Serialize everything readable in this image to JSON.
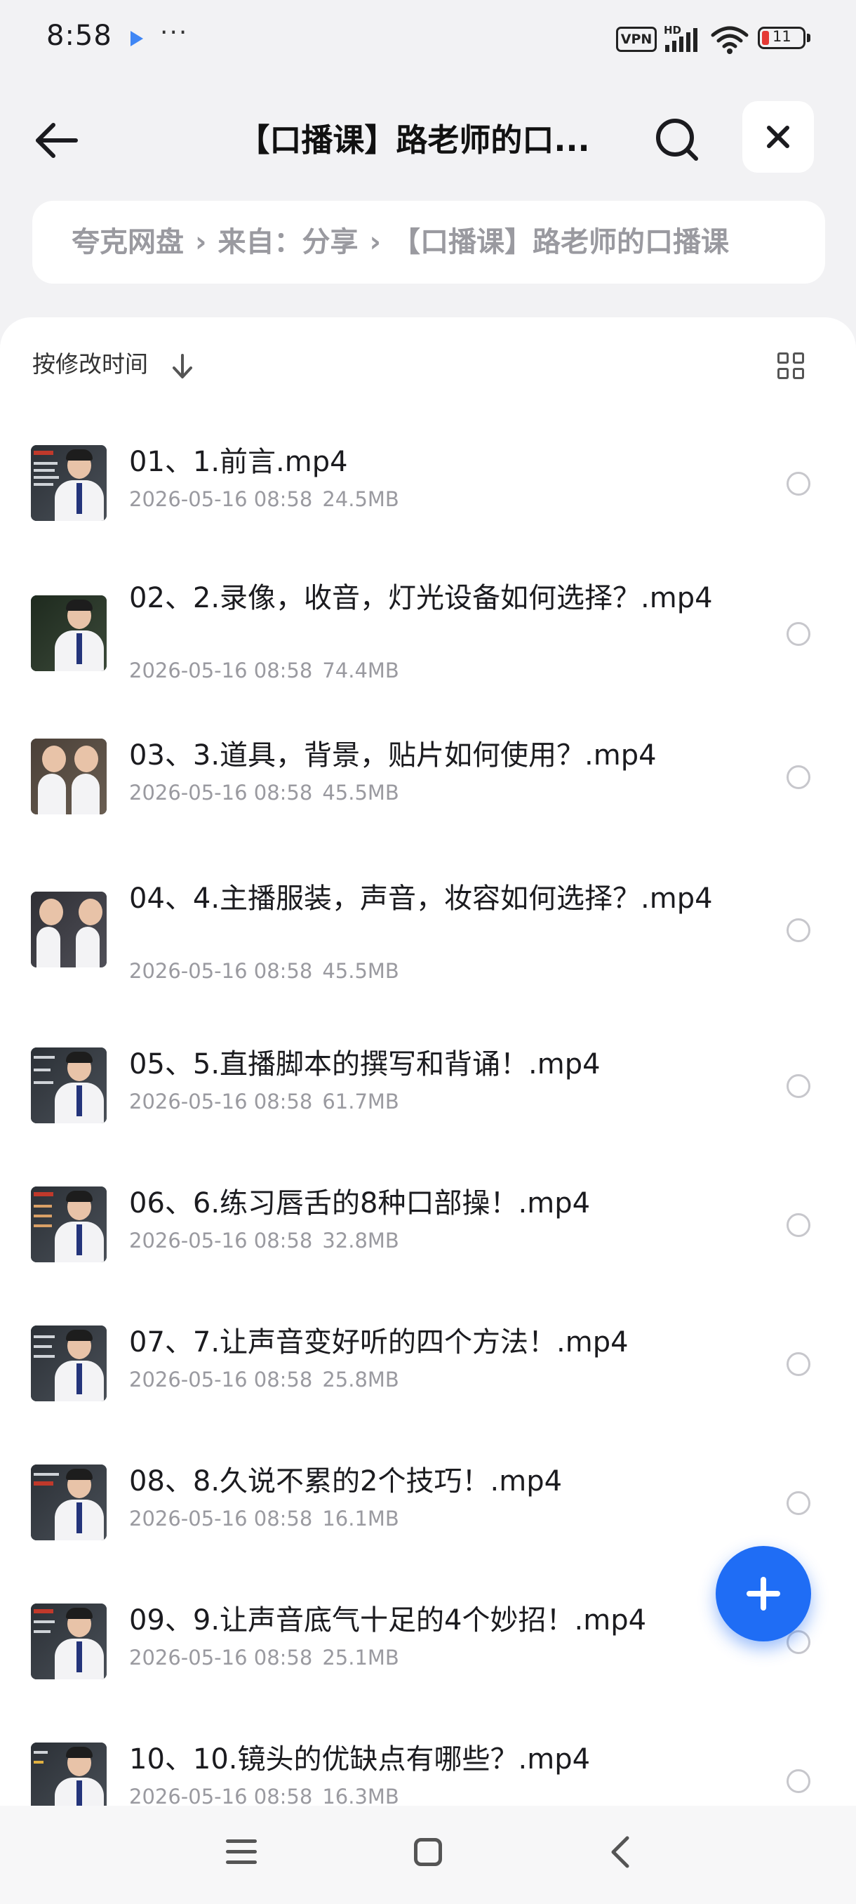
{
  "status_bar": {
    "time": "8:58",
    "more": "···",
    "vpn": "VPN",
    "hd": "HD",
    "battery": "11"
  },
  "header": {
    "title": "【口播课】路老师的口..."
  },
  "breadcrumb": {
    "items": [
      "夸克网盘",
      "来自：分享",
      "【口播课】路老师的口播课"
    ]
  },
  "toolbar": {
    "sort_label": "按修改时间"
  },
  "files": [
    {
      "name": "01、1.前言.mp4",
      "date": "2026-05-16 08:58",
      "size": "24.5MB"
    },
    {
      "name": "02、2.录像，收音，灯光设备如何选择？.mp4",
      "date": "2026-05-16 08:58",
      "size": "74.4MB"
    },
    {
      "name": "03、3.道具，背景，贴片如何使用？.mp4",
      "date": "2026-05-16 08:58",
      "size": "45.5MB"
    },
    {
      "name": "04、4.主播服装，声音，妆容如何选择？.mp4",
      "date": "2026-05-16 08:58",
      "size": "45.5MB"
    },
    {
      "name": "05、5.直播脚本的撰写和背诵！.mp4",
      "date": "2026-05-16 08:58",
      "size": "61.7MB"
    },
    {
      "name": "06、6.练习唇舌的8种口部操！.mp4",
      "date": "2026-05-16 08:58",
      "size": "32.8MB"
    },
    {
      "name": "07、7.让声音变好听的四个方法！.mp4",
      "date": "2026-05-16 08:58",
      "size": "25.8MB"
    },
    {
      "name": "08、8.久说不累的2个技巧！.mp4",
      "date": "2026-05-16 08:58",
      "size": "16.1MB"
    },
    {
      "name": "09、9.让声音底气十足的4个妙招！.mp4",
      "date": "2026-05-16 08:58",
      "size": "25.1MB"
    },
    {
      "name": "10、10.镜头的优缺点有哪些？.mp4",
      "date": "2026-05-16 08:58",
      "size": "16.3MB"
    }
  ],
  "colors": {
    "accent": "#1f6df5",
    "background": "#f2f2f4",
    "muted_text": "#9a9aa0",
    "battery_low": "#e53935"
  },
  "icons": {
    "back": "arrow-left-icon",
    "search": "search-icon",
    "close": "close-icon",
    "breadcrumb_separator": "chevron-right-icon",
    "sort": "arrow-down-icon",
    "view": "grid-view-icon",
    "fab": "plus-icon"
  }
}
